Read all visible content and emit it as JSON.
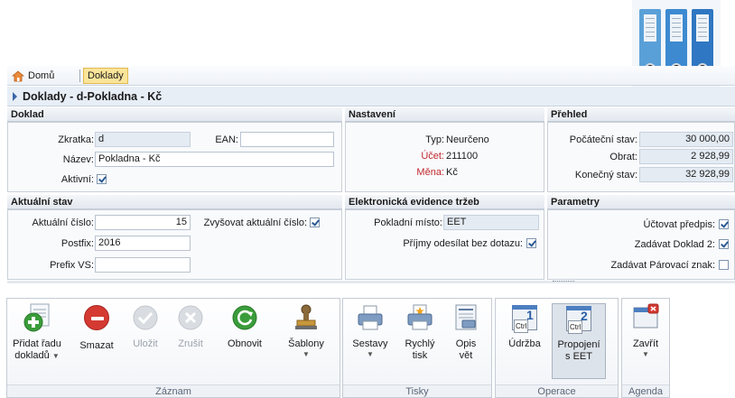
{
  "breadcrumb": {
    "home": "Domů",
    "current": "Doklady"
  },
  "page_title": "Doklady - d-Pokladna - Kč",
  "doklad": {
    "title": "Doklad",
    "zkratka_label": "Zkratka:",
    "zkratka_value": "d",
    "ean_label": "EAN:",
    "ean_value": "",
    "nazev_label": "Název:",
    "nazev_value": "Pokladna - Kč",
    "aktivni_label": "Aktivní:",
    "aktivni_checked": true
  },
  "nastaveni": {
    "title": "Nastavení",
    "typ_label": "Typ:",
    "typ_value": "Neurčeno",
    "ucet_label": "Účet:",
    "ucet_value": "211100",
    "mena_label": "Měna:",
    "mena_value": "Kč"
  },
  "prehled": {
    "title": "Přehled",
    "pocatecni_label": "Počáteční stav:",
    "pocatecni_value": "30 000,00",
    "obrat_label": "Obrat:",
    "obrat_value": "2 928,99",
    "konecny_label": "Konečný stav:",
    "konecny_value": "32 928,99"
  },
  "aktualni_stav": {
    "title": "Aktuální stav",
    "cislo_label": "Aktuální číslo:",
    "cislo_value": "15",
    "zvysovat_label": "Zvyšovat aktuální číslo:",
    "zvysovat_checked": true,
    "postfix_label": "Postfix:",
    "postfix_value": "2016",
    "prefix_label": "Prefix VS:",
    "prefix_value": ""
  },
  "eet": {
    "title": "Elektronická evidence tržeb",
    "misto_label": "Pokladní místo:",
    "misto_value": "EET",
    "prijmy_label": "Příjmy odesílat bez dotazu:",
    "prijmy_checked": true
  },
  "parametry": {
    "title": "Parametry",
    "uctovat_label": "Účtovat předpis:",
    "uctovat_checked": true,
    "zadavat_doklad_label": "Zadávat Doklad 2:",
    "zadavat_doklad_checked": true,
    "zadavat_znak_label": "Zadávat Párovací znak:",
    "zadavat_znak_checked": false
  },
  "ribbon": {
    "zaznam": {
      "label": "Záznam",
      "pridat_1": "Přidat řadu",
      "pridat_2": "dokladů",
      "smazat": "Smazat",
      "ulozit": "Uložit",
      "zrusit": "Zrušit",
      "obnovit": "Obnovit",
      "sablony": "Šablony"
    },
    "tisky": {
      "label": "Tisky",
      "sestavy": "Sestavy",
      "rychly_1": "Rychlý",
      "rychly_2": "tisk",
      "opis_1": "Opis",
      "opis_2": "vět"
    },
    "operace": {
      "label": "Operace",
      "udrzba": "Údržba",
      "propojeni_1": "Propojení",
      "propojeni_2": "s EET",
      "ctrl": "Ctrl",
      "num1": "1",
      "num2": "2"
    },
    "agenda": {
      "label": "Agenda",
      "zavrit": "Zavřít"
    }
  },
  "colors": {
    "accent": "#2a6fc4",
    "highlight": "#fbe59a",
    "delete": "#d43a32",
    "add": "#3a9c3a"
  }
}
